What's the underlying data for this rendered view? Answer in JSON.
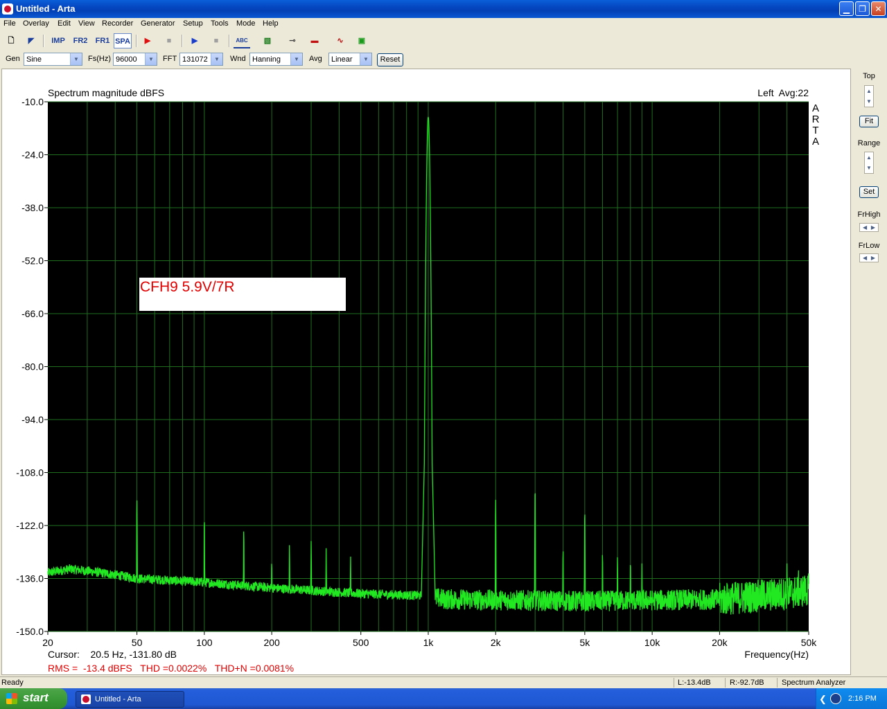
{
  "window": {
    "title": "Untitled - Arta"
  },
  "menu": [
    "File",
    "Overlay",
    "Edit",
    "View",
    "Recorder",
    "Generator",
    "Setup",
    "Tools",
    "Mode",
    "Help"
  ],
  "toolbar": {
    "imp": "IMP",
    "fr2": "FR2",
    "fr1": "FR1",
    "spa": "SPA",
    "abc": "ABC"
  },
  "params": {
    "gen_label": "Gen",
    "gen_value": "Sine",
    "fs_label": "Fs(Hz)",
    "fs_value": "96000",
    "fft_label": "FFT",
    "fft_value": "131072",
    "wnd_label": "Wnd",
    "wnd_value": "Hanning",
    "avg_label": "Avg",
    "avg_value": "Linear",
    "reset_label": "Reset"
  },
  "right_panel": {
    "top_label": "Top",
    "fit_label": "Fit",
    "range_label": "Range",
    "set_label": "Set",
    "frhigh_label": "FrHigh",
    "frlow_label": "FrLow"
  },
  "chart_data": {
    "type": "line",
    "title": "Spectrum magnitude dBFS",
    "channel_text": "Left  Avg:22",
    "side_label": "ARTA",
    "xlabel": "Frequency(Hz)",
    "ylabel": "",
    "xscale": "log",
    "xlim": [
      20,
      50000
    ],
    "ylim": [
      -150,
      -10
    ],
    "y_ticks": [
      "-10.0",
      "-24.0",
      "-38.0",
      "-52.0",
      "-66.0",
      "-80.0",
      "-94.0",
      "-108.0",
      "-122.0",
      "-136.0",
      "-150.0"
    ],
    "x_ticks": [
      {
        "v": 20,
        "label": "20"
      },
      {
        "v": 50,
        "label": "50"
      },
      {
        "v": 100,
        "label": "100"
      },
      {
        "v": 200,
        "label": "200"
      },
      {
        "v": 500,
        "label": "500"
      },
      {
        "v": 1000,
        "label": "1k"
      },
      {
        "v": 2000,
        "label": "2k"
      },
      {
        "v": 5000,
        "label": "5k"
      },
      {
        "v": 10000,
        "label": "10k"
      },
      {
        "v": 20000,
        "label": "20k"
      },
      {
        "v": 50000,
        "label": "50k"
      }
    ],
    "grid": true,
    "background": "#000000",
    "grid_color": "#1f6f1f",
    "trace_color": "#22e822",
    "annotation": "CFH9 5.9V/7R",
    "annotation_color": "#e00000",
    "noise_floor": [
      {
        "f": 20,
        "db": -134.5
      },
      {
        "f": 25,
        "db": -133.5
      },
      {
        "f": 30,
        "db": -134
      },
      {
        "f": 40,
        "db": -135
      },
      {
        "f": 50,
        "db": -136
      },
      {
        "f": 100,
        "db": -137
      },
      {
        "f": 200,
        "db": -138.5
      },
      {
        "f": 500,
        "db": -140
      },
      {
        "f": 900,
        "db": -140.5
      },
      {
        "f": 1200,
        "db": -141.5
      },
      {
        "f": 5000,
        "db": -142
      },
      {
        "f": 20000,
        "db": -141.5
      },
      {
        "f": 40000,
        "db": -140
      },
      {
        "f": 50000,
        "db": -139
      }
    ],
    "peaks": [
      {
        "f": 50,
        "db": -115
      },
      {
        "f": 100,
        "db": -120
      },
      {
        "f": 150,
        "db": -123
      },
      {
        "f": 200,
        "db": -131
      },
      {
        "f": 240,
        "db": -127
      },
      {
        "f": 300,
        "db": -126
      },
      {
        "f": 350,
        "db": -128
      },
      {
        "f": 450,
        "db": -130
      },
      {
        "f": 1000,
        "db": -14
      },
      {
        "f": 2000,
        "db": -115
      },
      {
        "f": 3000,
        "db": -112
      },
      {
        "f": 4000,
        "db": -128
      },
      {
        "f": 5000,
        "db": -118
      },
      {
        "f": 6000,
        "db": -129
      },
      {
        "f": 7000,
        "db": -130
      },
      {
        "f": 8000,
        "db": -131
      },
      {
        "f": 9000,
        "db": -132
      },
      {
        "f": 40000,
        "db": -132
      },
      {
        "f": 45000,
        "db": -133
      }
    ],
    "cursor_text": "Cursor:    20.5 Hz, -131.80 dB",
    "stats_text": "RMS =  -13.4 dBFS   THD =0.0022%   THD+N =0.0081%"
  },
  "status": {
    "ready": "Ready",
    "left_level": "L:-13.4dB",
    "right_level": "R:-92.7dB",
    "mode": "Spectrum Analyzer"
  },
  "taskbar": {
    "start_label": "start",
    "task_label": "Untitled - Arta",
    "clock": "2:16 PM"
  }
}
